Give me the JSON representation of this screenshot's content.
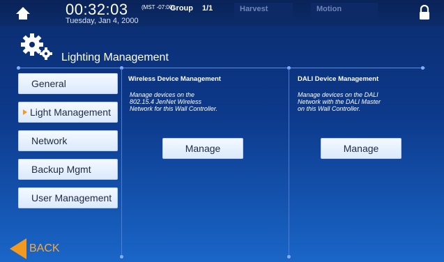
{
  "status_bar": {
    "time": "00:32:03",
    "timezone": "(MST -07:00)",
    "date": "Tuesday, Jan 4, 2000",
    "group_label": "Group",
    "group_value": "1/1",
    "harvest_label": "Harvest",
    "motion_label": "Motion",
    "home_icon": "home-icon",
    "lock_icon": "lock-icon"
  },
  "header": {
    "title": "Lighting Management",
    "icon": "gears-icon"
  },
  "nav": {
    "items": [
      {
        "label": "General"
      },
      {
        "label": "Light Management"
      },
      {
        "label": "Network"
      },
      {
        "label": "Backup Mgmt"
      },
      {
        "label": "User Management"
      }
    ],
    "active_index": 1,
    "active_marker_color": "#f29a1f"
  },
  "panels": {
    "wireless": {
      "title": "Wireless Device Management",
      "desc_lines": [
        "Manage devices on the",
        "802.15.4 JenNet Wireless",
        "Network for this Wall Controller."
      ],
      "button": "Manage"
    },
    "dali": {
      "title": "DALI Device Management",
      "desc_lines": [
        "Manage devices on the DALI",
        "Network with the DALI Master",
        "on this Wall Controller."
      ],
      "button": "Manage"
    }
  },
  "back": {
    "label": "BACK",
    "color": "#f29a1f"
  }
}
